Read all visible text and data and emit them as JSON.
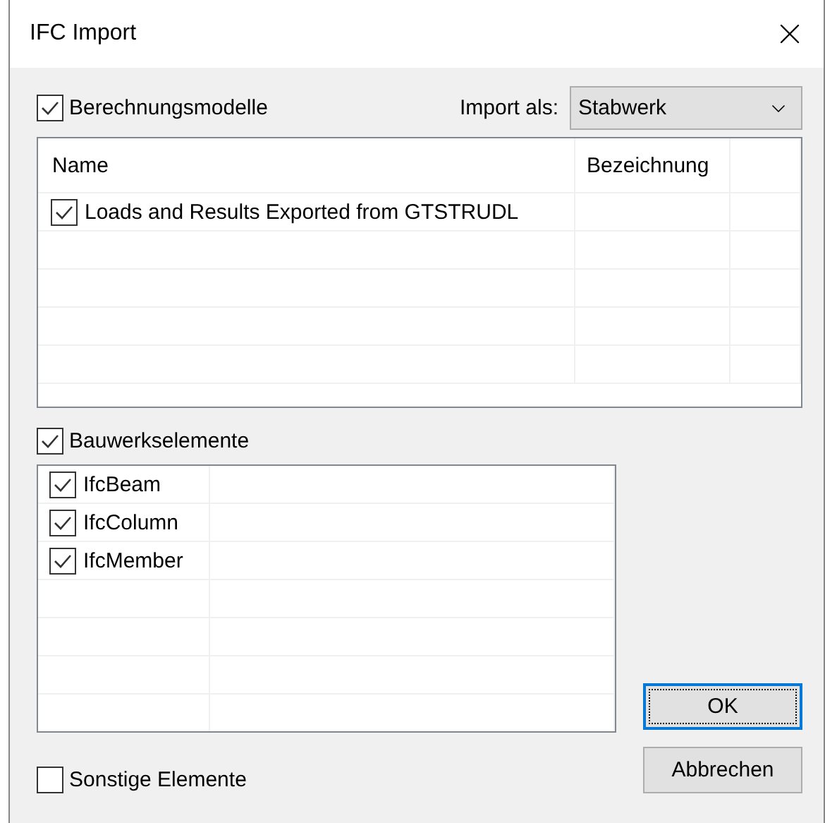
{
  "window": {
    "title": "IFC Import"
  },
  "models": {
    "label": "Berechnungsmodelle",
    "checked": true,
    "import_label": "Import als:",
    "import_value": "Stabwerk",
    "columns": [
      "Name",
      "Bezeichnung"
    ],
    "rows": [
      {
        "name": "Loads and Results Exported from GTSTRUDL",
        "checked": true
      }
    ]
  },
  "elements": {
    "label": "Bauwerkselemente",
    "checked": true,
    "rows": [
      {
        "name": "IfcBeam",
        "checked": true
      },
      {
        "name": "IfcColumn",
        "checked": true
      },
      {
        "name": "IfcMember",
        "checked": true
      }
    ]
  },
  "other": {
    "label": "Sonstige Elemente",
    "checked": false
  },
  "buttons": [
    {
      "label": "OK",
      "default": true
    },
    {
      "label": "Abbrechen",
      "default": false
    }
  ]
}
